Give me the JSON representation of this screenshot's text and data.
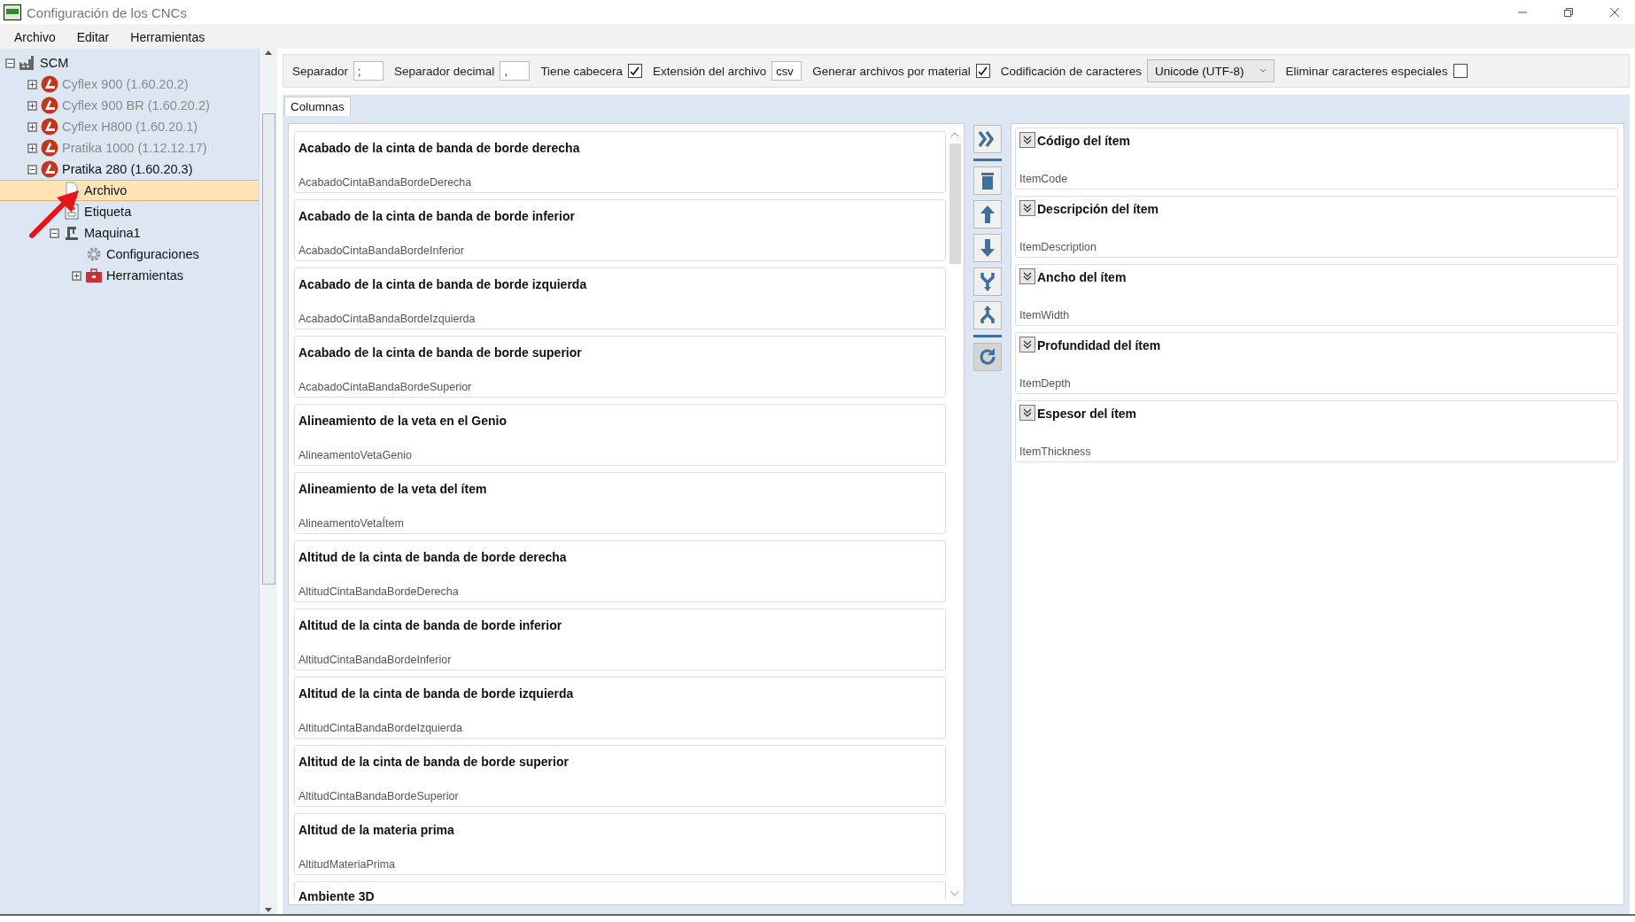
{
  "window": {
    "title": "Configuración de los CNCs"
  },
  "menu": [
    "Archivo",
    "Editar",
    "Herramientas"
  ],
  "tree": [
    {
      "label": "SCM",
      "kind": "factory",
      "expanded": true,
      "dimmed": false,
      "selected": false,
      "children": [
        {
          "label": "Cyflex 900 (1.60.20.2)",
          "kind": "brand",
          "expanded": false,
          "dimmed": true,
          "selected": false
        },
        {
          "label": "Cyflex 900 BR (1.60.20.2)",
          "kind": "brand",
          "expanded": false,
          "dimmed": true,
          "selected": false
        },
        {
          "label": "Cyflex H800 (1.60.20.1)",
          "kind": "brand",
          "expanded": false,
          "dimmed": true,
          "selected": false
        },
        {
          "label": "Pratika 1000 (1.12.12.17)",
          "kind": "brand",
          "expanded": false,
          "dimmed": true,
          "selected": false
        },
        {
          "label": "Pratika 280 (1.60.20.3)",
          "kind": "brand",
          "expanded": true,
          "dimmed": false,
          "selected": false,
          "children": [
            {
              "label": "Archivo",
              "kind": "document",
              "dimmed": false,
              "selected": true
            },
            {
              "label": "Etiqueta",
              "kind": "label",
              "dimmed": false,
              "selected": false
            },
            {
              "label": "Maquina1",
              "kind": "machine",
              "expanded": true,
              "dimmed": false,
              "selected": false,
              "children": [
                {
                  "label": "Configuraciones",
                  "kind": "gear",
                  "dimmed": false,
                  "selected": false
                },
                {
                  "label": "Herramientas",
                  "kind": "toolbox",
                  "expanded": false,
                  "dimmed": false,
                  "selected": false
                }
              ]
            }
          ]
        }
      ]
    }
  ],
  "options": [
    {
      "kind": "field",
      "label": "Separador",
      "value": ";"
    },
    {
      "kind": "field",
      "label": "Separador decimal",
      "value": ","
    },
    {
      "kind": "checkbox",
      "label": "Tiene cabecera",
      "checked": true
    },
    {
      "kind": "field",
      "label": "Extensión del archivo",
      "value": "csv"
    },
    {
      "kind": "checkbox",
      "label": "Generar archivos por material",
      "checked": true
    },
    {
      "kind": "dropdown",
      "label": "Codificación de caracteres",
      "value": "Unicode (UTF-8)"
    },
    {
      "kind": "checkbox",
      "label": "Eliminar caracteres especiales",
      "checked": false
    }
  ],
  "tabs": [
    {
      "label": "Columnas",
      "selected": true
    }
  ],
  "available_columns": [
    {
      "title": "Acabado de la cinta de banda de borde derecha",
      "field": "AcabadoCintaBandaBordeDerecha"
    },
    {
      "title": "Acabado de la cinta de banda de borde inferior",
      "field": "AcabadoCintaBandaBordeInferior"
    },
    {
      "title": "Acabado de la cinta de banda de borde izquierda",
      "field": "AcabadoCintaBandaBordeIzquierda"
    },
    {
      "title": "Acabado de la cinta de banda de borde superior",
      "field": "AcabadoCintaBandaBordeSuperior"
    },
    {
      "title": "Alineamiento de la veta en el Genio",
      "field": "AlineamentoVetaGenio"
    },
    {
      "title": "Alineamiento de la veta del ítem",
      "field": "AlineamentoVetaÍtem"
    },
    {
      "title": "Altitud de la cinta de banda de borde derecha",
      "field": "AltitudCintaBandaBordeDerecha"
    },
    {
      "title": "Altitud de la cinta de banda de borde inferior",
      "field": "AltitudCintaBandaBordeInferior"
    },
    {
      "title": "Altitud de la cinta de banda de borde izquierda",
      "field": "AltitudCintaBandaBordeIzquierda"
    },
    {
      "title": "Altitud de la cinta de banda de borde superior",
      "field": "AltitudCintaBandaBordeSuperior"
    },
    {
      "title": "Altitud de la materia prima",
      "field": "AltitudMateriaPrima"
    },
    {
      "title": "Ambiente 3D"
    }
  ],
  "tools": [
    {
      "kind": "add-all"
    },
    {
      "kind": "separator"
    },
    {
      "kind": "delete"
    },
    {
      "kind": "up"
    },
    {
      "kind": "down"
    },
    {
      "kind": "merge"
    },
    {
      "kind": "split"
    },
    {
      "kind": "separator"
    },
    {
      "kind": "refresh"
    }
  ],
  "selected_columns": [
    {
      "title": "Código del ítem",
      "field": "ItemCode"
    },
    {
      "title": "Descripción del ítem",
      "field": "ItemDescription"
    },
    {
      "title": "Ancho del ítem",
      "field": "ItemWidth"
    },
    {
      "title": "Profundidad del ítem",
      "field": "ItemDepth"
    },
    {
      "title": "Espesor del ítem",
      "field": "ItemThickness"
    }
  ]
}
